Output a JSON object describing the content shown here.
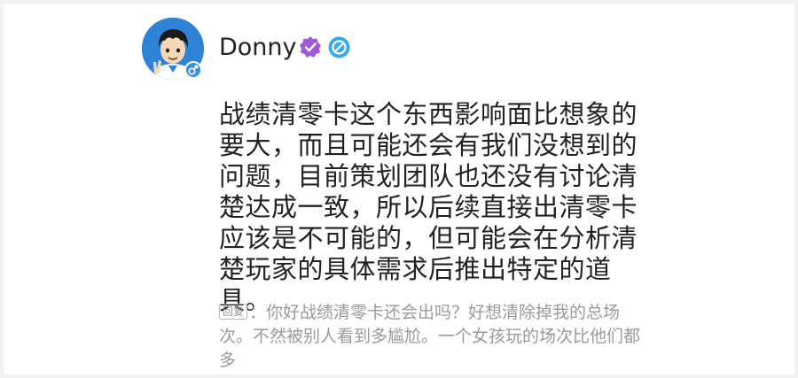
{
  "user": {
    "name": "Donny",
    "avatar_icon": "cartoon-boy-avatar-icon",
    "gender_icon": "male-icon",
    "badges": [
      "verified-icon",
      "level-icon"
    ]
  },
  "post": {
    "text": "战绩清零卡这个东西影响面比想象的要大，而且可能还会有我们没想到的问题，目前策划团队也还没有讨论清楚达成一致，所以后续直接出清零卡应该是不可能的，但可能会在分析清楚玩家的具体需求后推出特定的道具。"
  },
  "reply": {
    "tag": "回复",
    "separator": "：",
    "text": "你好战绩清零卡还会出吗？好想清除掉我的总场次。不然被别人看到多尴尬。一个女孩玩的场次比他们都多"
  },
  "colors": {
    "avatar_bg": "#2f83d6",
    "verified": "#a05ad6",
    "level": "#3aa9e8",
    "text": "#222222",
    "reply_text": "#9a9a9a"
  }
}
